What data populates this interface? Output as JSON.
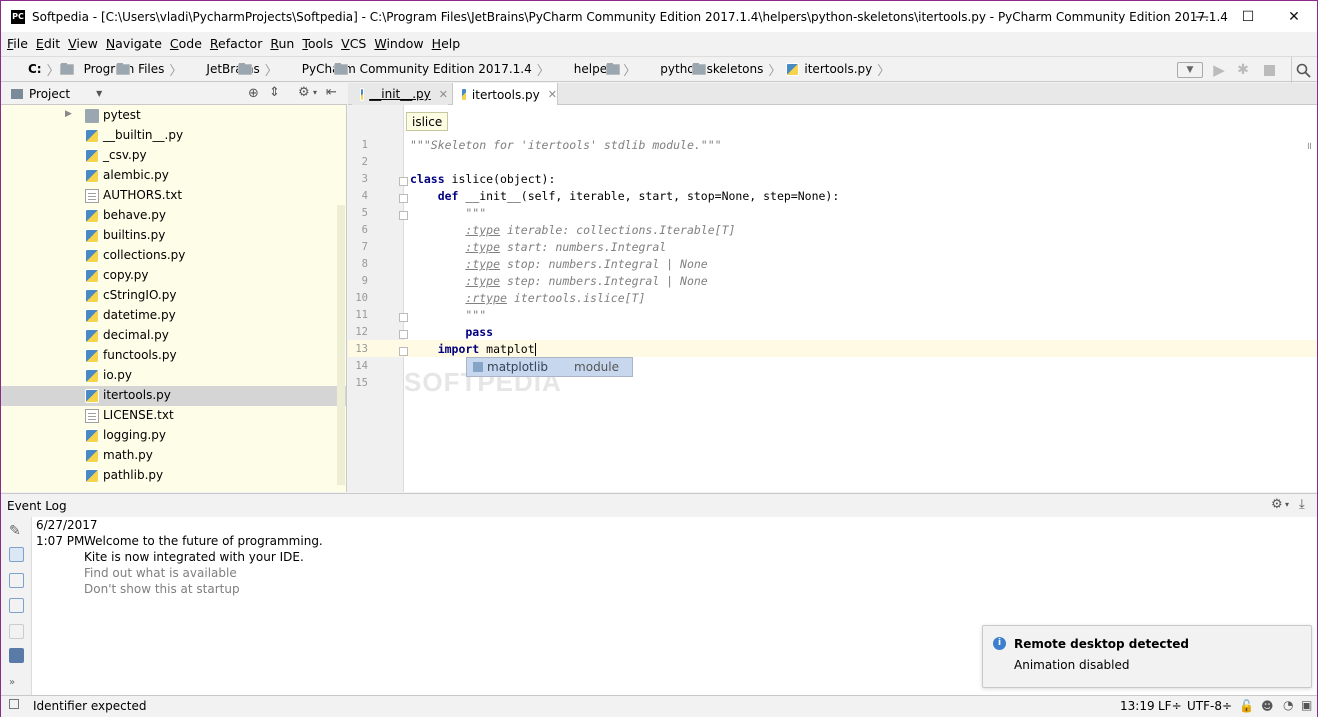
{
  "window": {
    "title": "Softpedia - [C:\\Users\\vladi\\PycharmProjects\\Softpedia] - C:\\Program Files\\JetBrains\\PyCharm Community Edition 2017.1.4\\helpers\\python-skeletons\\itertools.py - PyCharm Community Edition 2017.1.4",
    "app_icon": "PC",
    "minimize": "—",
    "maximize": "☐",
    "close": "✕"
  },
  "menu": [
    "File",
    "Edit",
    "View",
    "Navigate",
    "Code",
    "Refactor",
    "Run",
    "Tools",
    "VCS",
    "Window",
    "Help"
  ],
  "breadcrumbs": [
    "C:",
    "Program Files",
    "JetBrains",
    "PyCharm Community Edition 2017.1.4",
    "helpers",
    "python-skeletons",
    "itertools.py"
  ],
  "project_panel": {
    "title": "Project",
    "items": [
      {
        "label": "pytest",
        "type": "folder"
      },
      {
        "label": "__builtin__.py",
        "type": "py"
      },
      {
        "label": "_csv.py",
        "type": "py"
      },
      {
        "label": "alembic.py",
        "type": "py"
      },
      {
        "label": "AUTHORS.txt",
        "type": "txt"
      },
      {
        "label": "behave.py",
        "type": "py"
      },
      {
        "label": "builtins.py",
        "type": "py"
      },
      {
        "label": "collections.py",
        "type": "py"
      },
      {
        "label": "copy.py",
        "type": "py"
      },
      {
        "label": "cStringIO.py",
        "type": "py"
      },
      {
        "label": "datetime.py",
        "type": "py"
      },
      {
        "label": "decimal.py",
        "type": "py"
      },
      {
        "label": "functools.py",
        "type": "py"
      },
      {
        "label": "io.py",
        "type": "py"
      },
      {
        "label": "itertools.py",
        "type": "py",
        "selected": true
      },
      {
        "label": "LICENSE.txt",
        "type": "txt"
      },
      {
        "label": "logging.py",
        "type": "py"
      },
      {
        "label": "math.py",
        "type": "py"
      },
      {
        "label": "pathlib.py",
        "type": "py"
      }
    ]
  },
  "tabs": [
    {
      "label": "__init__.py",
      "active": false
    },
    {
      "label": "itertools.py",
      "active": true
    }
  ],
  "editor": {
    "breadcrumb_hint": "islice",
    "line_numbers": [
      "1",
      "2",
      "3",
      "4",
      "5",
      "6",
      "7",
      "8",
      "9",
      "10",
      "11",
      "12",
      "13",
      "14",
      "15"
    ],
    "lines": {
      "l1": "\"\"\"Skeleton for 'itertools' stdlib module.\"\"\"",
      "l3_kw": "class",
      "l3_rest": " islice(object):",
      "l4_kw": "    def",
      "l4_rest": " __init__(self, iterable, start, stop=None, step=None):",
      "l5": "        \"\"\"",
      "l6_tag": ":type",
      "l6_rest": " iterable: collections.Iterable[T]",
      "l7_tag": ":type",
      "l7_rest": " start: numbers.Integral",
      "l8_tag": ":type",
      "l8_rest": " stop: numbers.Integral | None",
      "l9_tag": ":type",
      "l9_rest": " step: numbers.Integral | None",
      "l10_tag": ":rtype",
      "l10_rest": " itertools.islice[T]",
      "l11": "        \"\"\"",
      "l12": "        pass",
      "l13_kw": "    import",
      "l13_rest": " matplot"
    },
    "completion": {
      "name": "matplotlib",
      "kind": "module"
    },
    "watermark": "SOFTPEDIA"
  },
  "event_log": {
    "title": "Event Log",
    "date": "6/27/2017",
    "time": "1:07 PM",
    "message_line1": "Welcome to the future of programming.",
    "message_line2": "Kite is now integrated with your IDE.",
    "link1": "Find out what is available",
    "link2": "Don't show this at startup"
  },
  "notification": {
    "title": "Remote desktop detected",
    "body": "Animation disabled"
  },
  "status": {
    "message": "Identifier expected",
    "position": "13:19",
    "line_sep": "LF÷",
    "encoding": "UTF-8÷"
  },
  "colors": {
    "accent": "#3875d7",
    "tree_bg": "#fdfde8",
    "selection": "#d5d5d5",
    "completion_bg": "#c7d7ee"
  }
}
